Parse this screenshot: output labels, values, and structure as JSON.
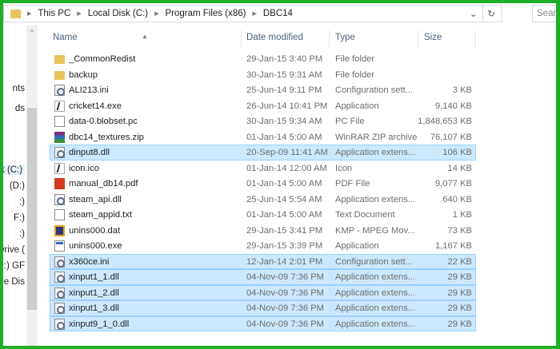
{
  "breadcrumb": [
    "This PC",
    "Local Disk (C:)",
    "Program Files (x86)",
    "DBC14"
  ],
  "search_placeholder": "Search",
  "nav": [
    "nts",
    "ds",
    "k (C:)",
    "(D:)",
    ":)",
    "F:)",
    ":)",
    "Drive (",
    "(I:) GF",
    "le Dis"
  ],
  "columns": {
    "name": "Name",
    "date": "Date modified",
    "type": "Type",
    "size": "Size"
  },
  "files": [
    {
      "name": "_CommonRedist",
      "date": "29-Jan-15 3:40 PM",
      "type": "File folder",
      "size": "",
      "icon": "folder",
      "selected": false
    },
    {
      "name": "backup",
      "date": "30-Jan-15 9:31 AM",
      "type": "File folder",
      "size": "",
      "icon": "folder",
      "selected": false
    },
    {
      "name": "ALI213.ini",
      "date": "25-Jun-14 9:11 PM",
      "type": "Configuration sett...",
      "size": "3 KB",
      "icon": "cfg",
      "selected": false
    },
    {
      "name": "cricket14.exe",
      "date": "26-Jun-14 10:41 PM",
      "type": "Application",
      "size": "9,140 KB",
      "icon": "exe",
      "selected": false
    },
    {
      "name": "data-0.blobset.pc",
      "date": "30-Jan-15 9:34 AM",
      "type": "PC File",
      "size": "1,848,653 KB",
      "icon": "doc",
      "selected": false
    },
    {
      "name": "dbc14_textures.zip",
      "date": "01-Jan-14 5:00 AM",
      "type": "WinRAR ZIP archive",
      "size": "76,107 KB",
      "icon": "zip",
      "selected": false
    },
    {
      "name": "dinput8.dll",
      "date": "20-Sep-09 11:41 AM",
      "type": "Application extens...",
      "size": "106 KB",
      "icon": "cfg",
      "selected": true
    },
    {
      "name": "icon.ico",
      "date": "01-Jan-14 12:00 AM",
      "type": "Icon",
      "size": "14 KB",
      "icon": "exe",
      "selected": false
    },
    {
      "name": "manual_db14.pdf",
      "date": "01-Jan-14 5:00 AM",
      "type": "PDF File",
      "size": "9,077 KB",
      "icon": "pdf",
      "selected": false
    },
    {
      "name": "steam_api.dll",
      "date": "25-Jun-14 5:54 AM",
      "type": "Application extens...",
      "size": "640 KB",
      "icon": "cfg",
      "selected": false
    },
    {
      "name": "steam_appid.txt",
      "date": "01-Jan-14 5:00 AM",
      "type": "Text Document",
      "size": "1 KB",
      "icon": "doc",
      "selected": false
    },
    {
      "name": "unins000.dat",
      "date": "29-Jan-15 3:41 PM",
      "type": "KMP - MPEG Mov...",
      "size": "73 KB",
      "icon": "dat",
      "selected": false
    },
    {
      "name": "unins000.exe",
      "date": "29-Jan-15 3:39 PM",
      "type": "Application",
      "size": "1,167 KB",
      "icon": "app",
      "selected": false
    },
    {
      "name": "x360ce.ini",
      "date": "12-Jan-14 2:01 PM",
      "type": "Configuration sett...",
      "size": "22 KB",
      "icon": "cfg",
      "selected": true
    },
    {
      "name": "xinput1_1.dll",
      "date": "04-Nov-09 7:36 PM",
      "type": "Application extens...",
      "size": "29 KB",
      "icon": "cfg",
      "selected": true
    },
    {
      "name": "xinput1_2.dll",
      "date": "04-Nov-09 7:36 PM",
      "type": "Application extens...",
      "size": "29 KB",
      "icon": "cfg",
      "selected": true
    },
    {
      "name": "xinput1_3.dll",
      "date": "04-Nov-09 7:36 PM",
      "type": "Application extens...",
      "size": "29 KB",
      "icon": "cfg",
      "selected": true
    },
    {
      "name": "xinput9_1_0.dll",
      "date": "04-Nov-09 7:36 PM",
      "type": "Application extens...",
      "size": "29 KB",
      "icon": "cfg",
      "selected": true
    }
  ]
}
